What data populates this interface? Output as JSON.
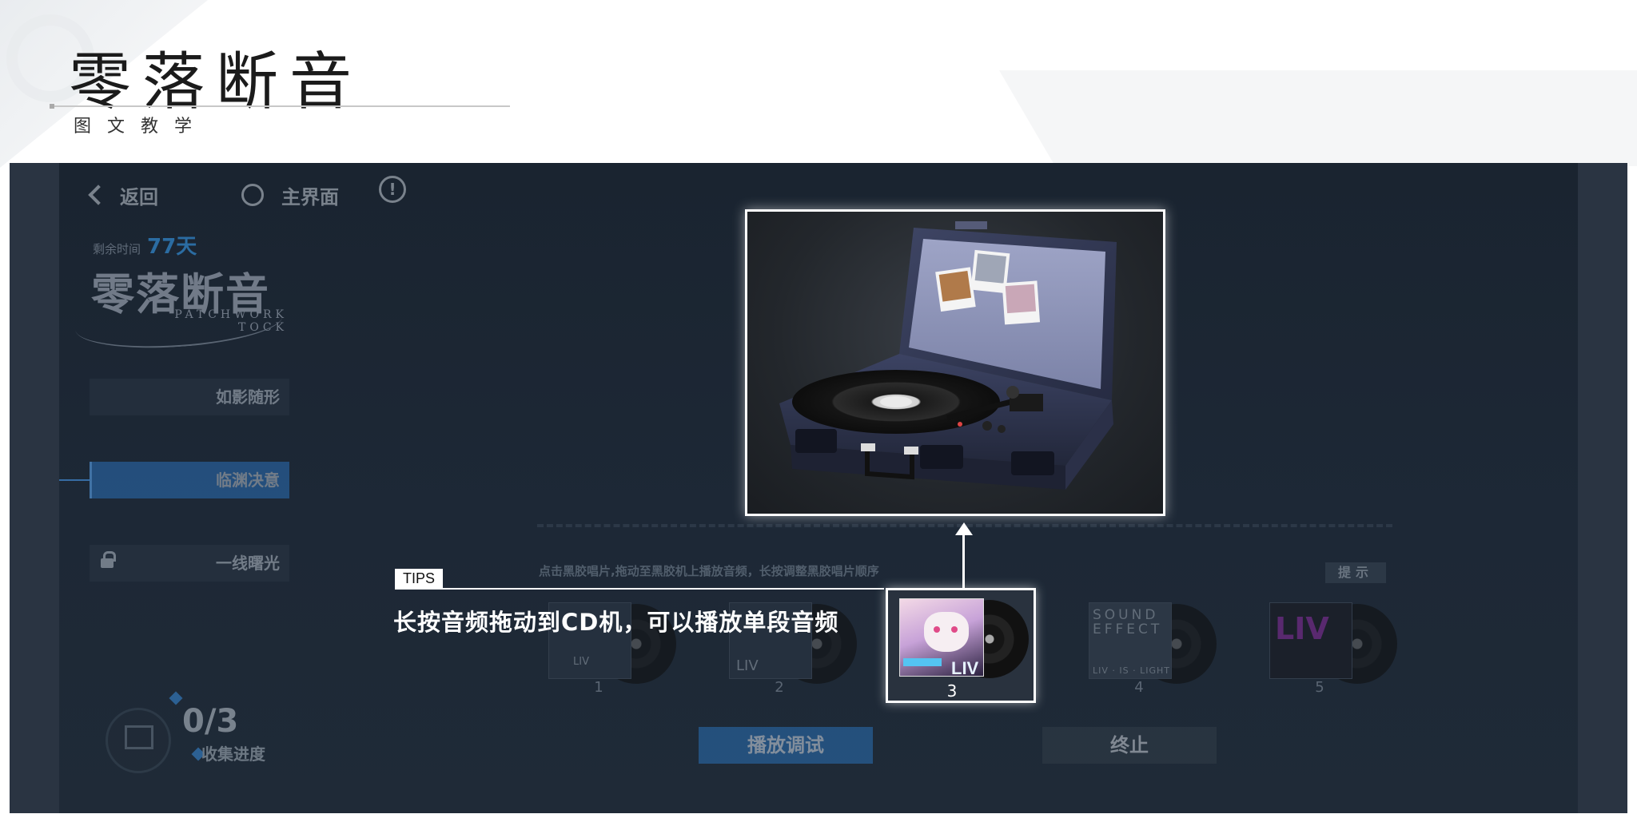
{
  "slide": {
    "title": "零落断音",
    "subtitle": "图文教学"
  },
  "game": {
    "nav": {
      "back_label": "返回",
      "home_label": "主界面"
    },
    "remaining": {
      "label": "剩余时间",
      "value": "77天"
    },
    "event_logo": {
      "cn": "零落断音",
      "en_line1": "PATCHWORK",
      "en_line2": "TOCK"
    },
    "stages": [
      {
        "label": "如影随形",
        "state": "normal"
      },
      {
        "label": "临渊决意",
        "state": "active"
      },
      {
        "label": "一线曙光",
        "state": "locked"
      }
    ],
    "progress": {
      "value": "0/3",
      "label": "收集进度"
    },
    "hint": "点击黑胶唱片,拖动至黑胶机上播放音频，长按调整黑胶唱片顺序",
    "hint_tag": "提示",
    "records": [
      {
        "num": "1",
        "cover": "LIV"
      },
      {
        "num": "2",
        "cover": "LIV"
      },
      {
        "num": "3",
        "cover": "LIV",
        "highlighted": true
      },
      {
        "num": "4",
        "cover": "SOUND EFFECT",
        "cover_sub": "LIV · IS · LIGHT"
      },
      {
        "num": "5",
        "cover": "LIV"
      }
    ],
    "buttons": {
      "play": "播放调试",
      "stop": "终止"
    },
    "colors": {
      "accent_blue": "#2a6fb6",
      "time_blue": "#3aa8ff",
      "panel_bg": "#1d2836"
    }
  },
  "tips": {
    "tag": "TIPS",
    "text": "长按音频拖动到CD机，可以播放单段音频"
  }
}
